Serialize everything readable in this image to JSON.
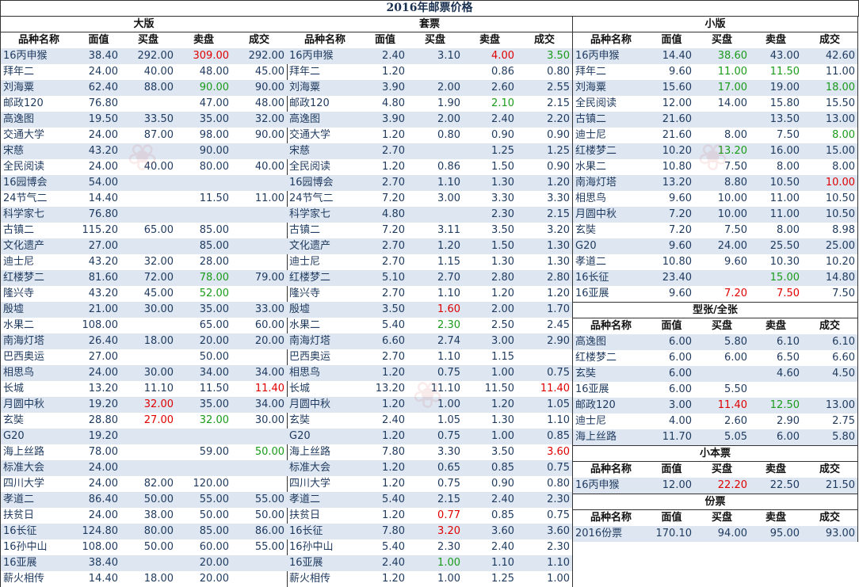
{
  "title": "2016年邮票价格",
  "columns": [
    "品种名称",
    "面值",
    "买盘",
    "卖盘",
    "成交"
  ],
  "colors": {
    "red": "#e00000",
    "green": "#1a9b1a",
    "row_alt": "#dde6f1"
  },
  "sections": {
    "dabang": {
      "title": "大版",
      "rows": [
        [
          "16丙申猴",
          "38.40",
          "292.00",
          "309.00:red",
          "292.00"
        ],
        [
          "拜年二",
          "24.00",
          "40.00",
          "48.00",
          "45.00"
        ],
        [
          "刘海粟",
          "62.40",
          "88.00",
          "90.00:green",
          "90.00"
        ],
        [
          "邮政120",
          "76.80",
          "",
          "47.00",
          "48.00"
        ],
        [
          "高逸图",
          "19.50",
          "33.50",
          "35.00",
          "32.00"
        ],
        [
          "交通大学",
          "24.00",
          "87.00",
          "98.00",
          "90.00"
        ],
        [
          "宋慈",
          "43.20",
          "",
          "90.00",
          ""
        ],
        [
          "全民阅读",
          "24.00",
          "40.00",
          "80.00",
          "40.00"
        ],
        [
          "16园博会",
          "54.00",
          "",
          "",
          ""
        ],
        [
          "24节气二",
          "14.40",
          "",
          "11.50",
          "11.00"
        ],
        [
          "科学家七",
          "76.80",
          "",
          "",
          ""
        ],
        [
          "古镇二",
          "115.20",
          "65.00",
          "85.00",
          ""
        ],
        [
          "文化遗产",
          "27.00",
          "",
          "85.00",
          ""
        ],
        [
          "迪士尼",
          "43.20",
          "32.00",
          "28.00",
          ""
        ],
        [
          "红楼梦二",
          "81.60",
          "72.00",
          "78.00:green",
          "79.00"
        ],
        [
          "隆兴寺",
          "43.20",
          "45.00",
          "52.00:green",
          ""
        ],
        [
          "殷墟",
          "21.00",
          "30.00",
          "35.00",
          "33.00"
        ],
        [
          "水果二",
          "108.00",
          "",
          "65.00",
          "60.00"
        ],
        [
          "南海灯塔",
          "26.40",
          "18.00",
          "20.00",
          "20.00"
        ],
        [
          "巴西奥运",
          "27.00",
          "",
          "50.00",
          ""
        ],
        [
          "相思鸟",
          "24.00",
          "30.00",
          "34.00",
          "34.00"
        ],
        [
          "长城",
          "13.20",
          "11.10",
          "11.50",
          "11.40:red"
        ],
        [
          "月圆中秋",
          "19.20",
          "32.00:red",
          "35.00",
          "34.00"
        ],
        [
          "玄奘",
          "28.80",
          "27.00:red",
          "32.00:green",
          "30.00"
        ],
        [
          "G20",
          "19.20",
          "",
          "",
          ""
        ],
        [
          "海上丝路",
          "78.00",
          "",
          "59.00",
          "50.00:green"
        ],
        [
          "标准大会",
          "24.00",
          "",
          "",
          ""
        ],
        [
          "四川大学",
          "24.00",
          "82.00",
          "120.00",
          ""
        ],
        [
          "孝道二",
          "86.40",
          "50.00",
          "55.00",
          "55.00"
        ],
        [
          "扶贫日",
          "24.00",
          "38.00",
          "50.00",
          "50.00"
        ],
        [
          "16长征",
          "124.80",
          "80.00",
          "85.00",
          "86.00"
        ],
        [
          "16孙中山",
          "108.00",
          "50.00",
          "60.00",
          "55.00"
        ],
        [
          "16亚展",
          "38.40",
          "",
          "20.00",
          ""
        ],
        [
          "薪火相传",
          "14.40",
          "18.00",
          "20.00",
          ""
        ]
      ]
    },
    "taopiao": {
      "title": "套票",
      "rows": [
        [
          "16丙申猴",
          "2.40",
          "3.10",
          "4.00:red",
          "3.50:green"
        ],
        [
          "拜年二",
          "1.20",
          "",
          "0.86",
          "0.80"
        ],
        [
          "刘海粟",
          "3.90",
          "2.00",
          "2.60",
          "2.55"
        ],
        [
          "邮政120",
          "4.80",
          "1.90",
          "2.10:green",
          "2.15"
        ],
        [
          "高逸图",
          "3.90",
          "2.00",
          "2.40",
          "2.20"
        ],
        [
          "交通大学",
          "1.20",
          "0.80",
          "0.90",
          "0.90"
        ],
        [
          "宋慈",
          "2.70",
          "",
          "1.25",
          "1.25"
        ],
        [
          "全民阅读",
          "1.20",
          "0.86",
          "1.50",
          "0.90"
        ],
        [
          "16园博会",
          "2.70",
          "1.10",
          "1.30",
          "1.20"
        ],
        [
          "24节气二",
          "7.20",
          "3.00",
          "3.30",
          "3.30"
        ],
        [
          "科学家七",
          "4.80",
          "",
          "2.30",
          "2.15"
        ],
        [
          "古镇二",
          "7.20",
          "3.11",
          "3.50",
          "3.20"
        ],
        [
          "文化遗产",
          "2.70",
          "1.20",
          "1.50",
          "1.30"
        ],
        [
          "迪士尼",
          "2.70",
          "1.15",
          "1.30",
          "1.30"
        ],
        [
          "红楼梦二",
          "5.10",
          "2.70",
          "2.80",
          "2.80"
        ],
        [
          "隆兴寺",
          "2.70",
          "1.10",
          "1.20",
          "1.20"
        ],
        [
          "殷墟",
          "3.50",
          "1.60:red",
          "2.00",
          "1.70"
        ],
        [
          "水果二",
          "5.40",
          "2.30:green",
          "2.50",
          "2.45"
        ],
        [
          "南海灯塔",
          "6.60",
          "2.74",
          "3.00",
          "2.90"
        ],
        [
          "巴西奥运",
          "2.70",
          "1.10",
          "1.15",
          ""
        ],
        [
          "相思鸟",
          "1.20",
          "0.75",
          "1.00",
          "0.75"
        ],
        [
          "长城",
          "13.20",
          "11.10",
          "11.50",
          "11.40:red"
        ],
        [
          "月圆中秋",
          "1.20",
          "1.00",
          "1.20",
          "1.05"
        ],
        [
          "玄奘",
          "2.40",
          "1.05",
          "1.30",
          "1.10"
        ],
        [
          "G20",
          "1.20",
          "0.75",
          "1.00",
          "0.85"
        ],
        [
          "海上丝路",
          "7.80",
          "3.30",
          "3.50",
          "3.60:red"
        ],
        [
          "标准大会",
          "1.20",
          "0.65",
          "0.85",
          "0.75"
        ],
        [
          "四川大学",
          "1.20",
          "0.75",
          "0.90",
          "0.80"
        ],
        [
          "孝道二",
          "5.40",
          "2.15",
          "2.40",
          "2.30"
        ],
        [
          "扶贫日",
          "1.20",
          "0.77:red",
          "0.85",
          "0.75"
        ],
        [
          "16长征",
          "7.80",
          "3.20:red",
          "3.60",
          "3.60"
        ],
        [
          "16孙中山",
          "5.40",
          "2.30",
          "2.40",
          "2.30"
        ],
        [
          "16亚展",
          "2.40",
          "1.00:green",
          "1.10",
          "1.10"
        ],
        [
          "薪火相传",
          "1.20",
          "1.00",
          "1.25",
          "1.00"
        ]
      ]
    },
    "xiaoban": {
      "title": "小版",
      "rows": [
        [
          "16丙申猴",
          "14.40",
          "38.60:green",
          "43.00",
          "42.60"
        ],
        [
          "拜年二",
          "9.60",
          "11.00:green",
          "11.50:green",
          "11.00"
        ],
        [
          "刘海粟",
          "15.60",
          "17.00:green",
          "19.00",
          "18.00:green"
        ],
        [
          "全民阅读",
          "12.00",
          "14.00",
          "15.80",
          "15.50"
        ],
        [
          "古镇二",
          "21.60",
          "",
          "13.50",
          "13.00"
        ],
        [
          "迪士尼",
          "21.60",
          "8.00",
          "7.50",
          "8.00:green"
        ],
        [
          "红楼梦二",
          "10.20",
          "13.20:green",
          "16.00",
          "15.00"
        ],
        [
          "水果二",
          "10.80",
          "7.50",
          "8.00",
          "8.00"
        ],
        [
          "南海灯塔",
          "13.20",
          "8.80",
          "10.50",
          "10.00:red"
        ],
        [
          "相思鸟",
          "9.60",
          "10.00",
          "11.00",
          "10.50"
        ],
        [
          "月圆中秋",
          "7.20",
          "10.00",
          "11.00",
          "10.50"
        ],
        [
          "玄奘",
          "7.20",
          "7.50",
          "8.00",
          "8.98"
        ],
        [
          "G20",
          "9.60",
          "24.00",
          "25.50",
          "25.00"
        ],
        [
          "孝道二",
          "10.80",
          "9.60",
          "10.30",
          "10.20"
        ],
        [
          "16长征",
          "23.40",
          "",
          "15.00:green",
          "14.80"
        ],
        [
          "16亚展",
          "9.60",
          "7.20:red",
          "7.50:red",
          "7.50"
        ]
      ]
    },
    "xingzhang": {
      "title": "型张/全张",
      "rows": [
        [
          "高逸图",
          "6.00",
          "5.80",
          "6.10",
          "6.10"
        ],
        [
          "红楼梦二",
          "6.00",
          "6.00",
          "6.50",
          "6.60"
        ],
        [
          "玄奘",
          "6.00",
          "",
          "4.60",
          "4.50"
        ],
        [
          "16亚展",
          "6.00",
          "5.50",
          "",
          ""
        ],
        [
          "邮政120",
          "3.00",
          "11.40:red",
          "12.50:green",
          "13.00"
        ],
        [
          "迪士尼",
          "4.00",
          "2.60",
          "2.90",
          "2.75"
        ],
        [
          "海上丝路",
          "11.70",
          "5.05",
          "6.00",
          "5.80"
        ]
      ]
    },
    "xiaobenpiao": {
      "title": "小本票",
      "rows": [
        [
          "16丙申猴",
          "12.00",
          "22.20:red",
          "22.50",
          "21.50"
        ]
      ]
    },
    "fenpiao": {
      "title": "份票",
      "rows": [
        [
          "2016份票",
          "170.10",
          "94.00",
          "95.00",
          "93.00"
        ]
      ]
    }
  }
}
